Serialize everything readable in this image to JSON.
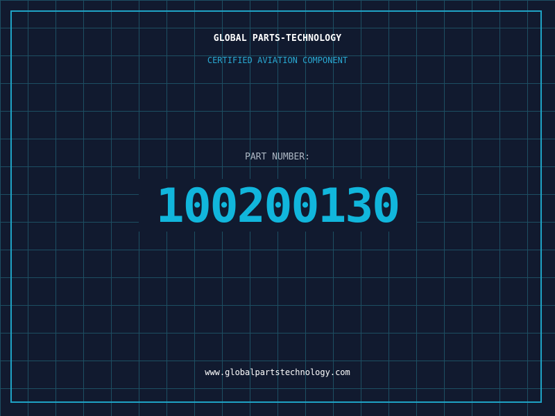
{
  "header": {
    "company": "GLOBAL PARTS-TECHNOLOGY",
    "tagline": "CERTIFIED AVIATION COMPONENT"
  },
  "part": {
    "label": "PART NUMBER:",
    "number": "100200130"
  },
  "footer": {
    "url": "www.globalpartstechnology.com"
  },
  "colors": {
    "background": "#111a2f",
    "grid": "#1d4f63",
    "accent": "#11b6dc",
    "frame": "#1fa3c6"
  }
}
